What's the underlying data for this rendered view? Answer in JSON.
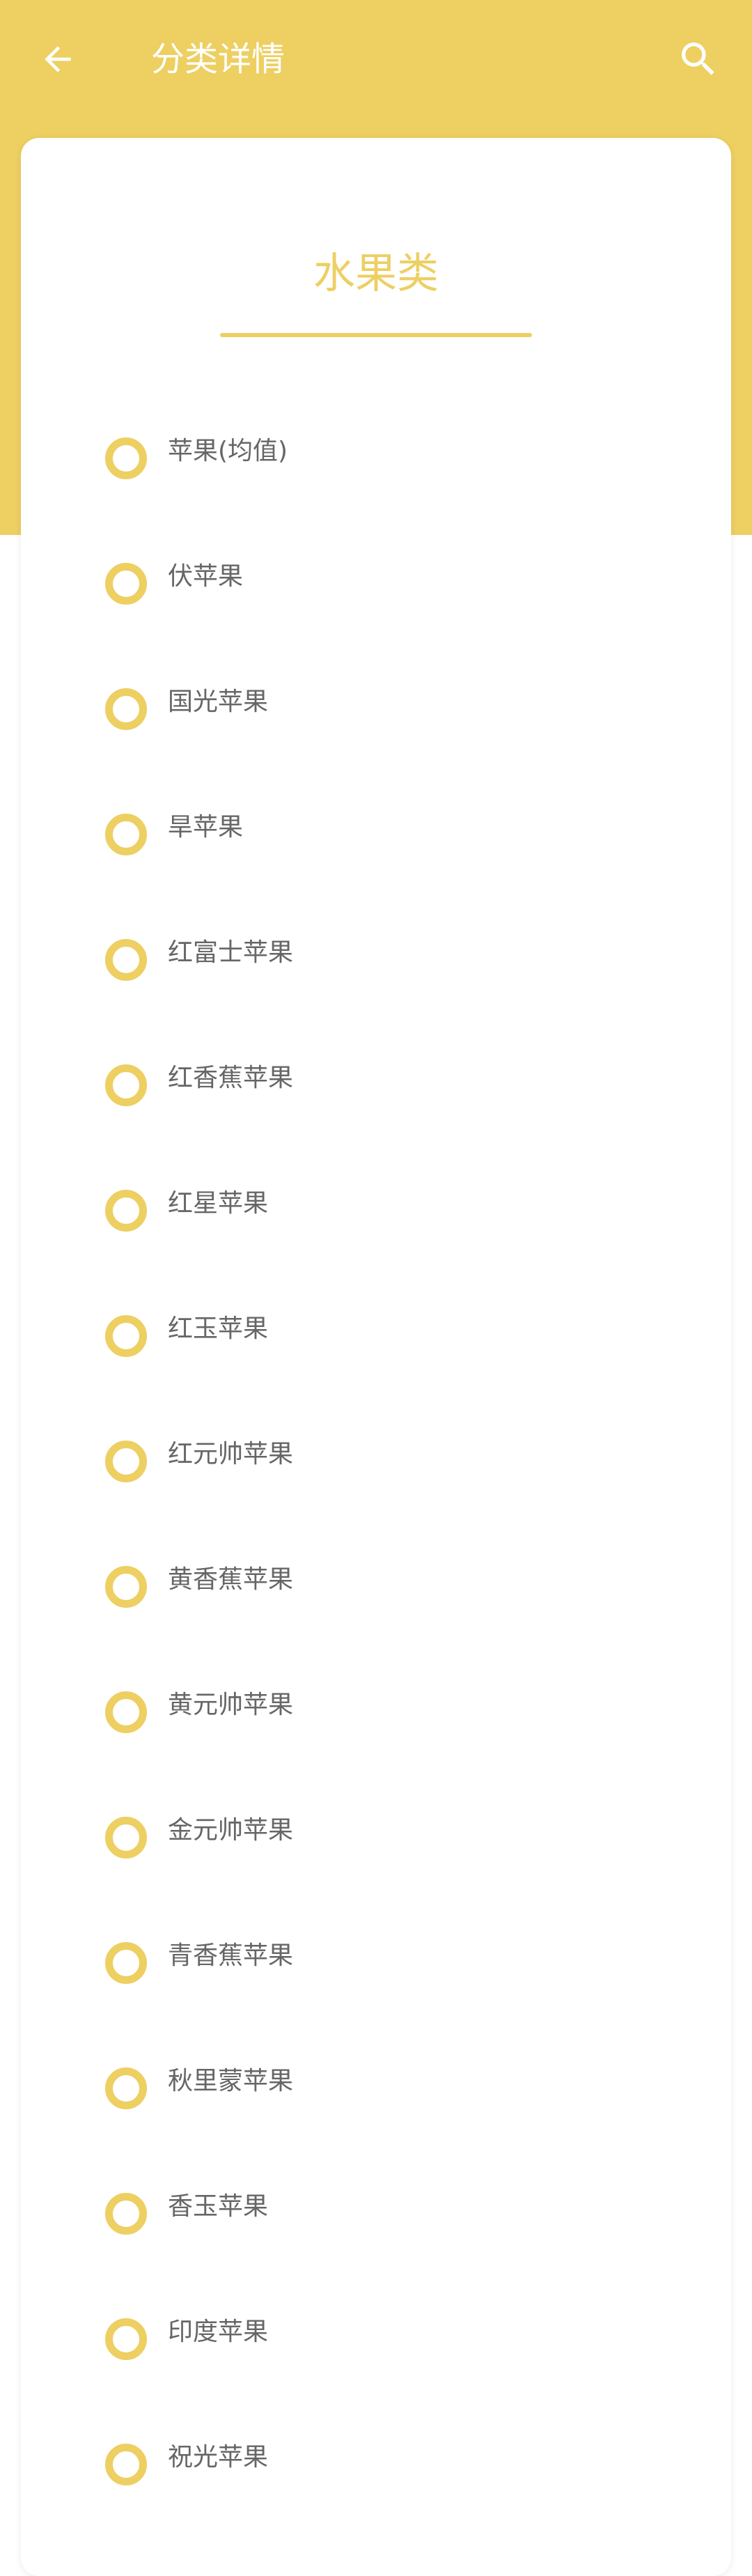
{
  "colors": {
    "accent": "#EDCF62",
    "text_gray": "#666666",
    "card_bg": "#ffffff"
  },
  "app_bar": {
    "back_icon": "arrow-left-icon",
    "title": "分类详情",
    "search_icon": "search-icon"
  },
  "category": {
    "title": "水果类"
  },
  "items": [
    {
      "label": "苹果(均值)"
    },
    {
      "label": "伏苹果"
    },
    {
      "label": "国光苹果"
    },
    {
      "label": "旱苹果"
    },
    {
      "label": "红富士苹果"
    },
    {
      "label": "红香蕉苹果"
    },
    {
      "label": "红星苹果"
    },
    {
      "label": "红玉苹果"
    },
    {
      "label": "红元帅苹果"
    },
    {
      "label": "黄香蕉苹果"
    },
    {
      "label": "黄元帅苹果"
    },
    {
      "label": "金元帅苹果"
    },
    {
      "label": "青香蕉苹果"
    },
    {
      "label": "秋里蒙苹果"
    },
    {
      "label": "香玉苹果"
    },
    {
      "label": "印度苹果"
    },
    {
      "label": "祝光苹果"
    }
  ]
}
